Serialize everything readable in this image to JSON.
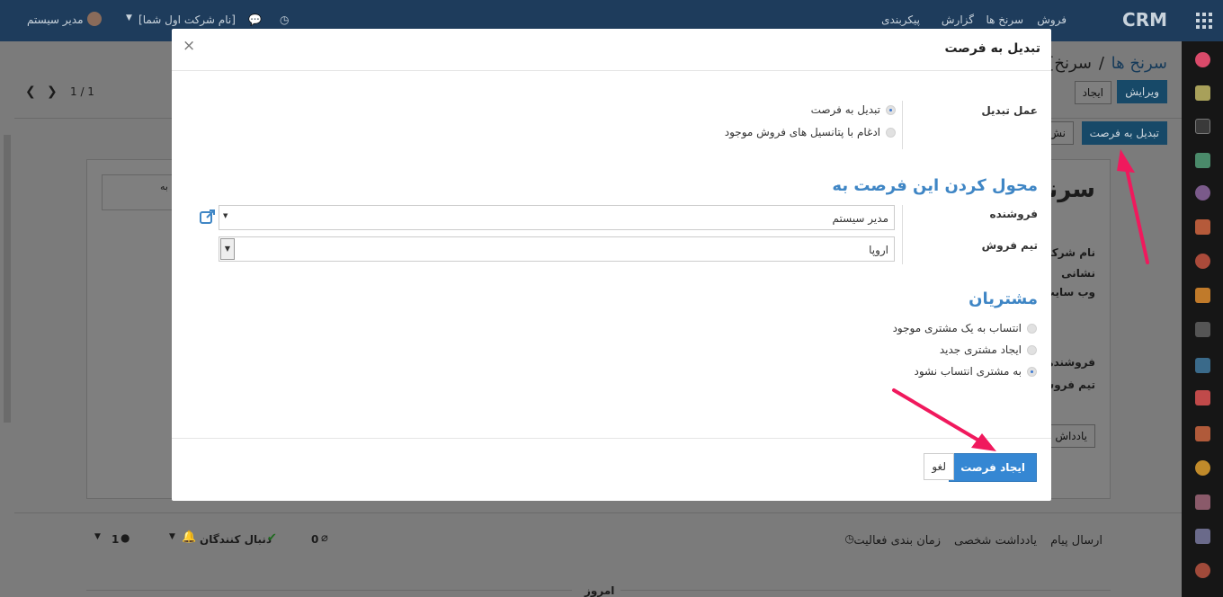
{
  "topbar": {
    "app_title": "CRM",
    "menu": [
      "فروش",
      "سرنخ ها",
      "گزارش",
      "پیکربندی"
    ],
    "user": "مدیر سیستم",
    "company": "[نام شرکت اول شما]"
  },
  "background": {
    "breadcrumb_root": "سرنخ ها",
    "breadcrumb_sep": "/",
    "breadcrumb_current": "[سرنخ",
    "edit_button": "ویرایش",
    "create_button": "ایجاد",
    "pager": "1 / 1",
    "convert_button": "تبدیل به فرصت",
    "mark_button": "نش",
    "record_title": "[سرنخ",
    "left_box_line1": "دیل به",
    "left_box_line2": "یف",
    "fields": [
      "نام شرکت",
      "نشانی",
      "وب سایت",
      "فروشنده",
      "تیم فروش"
    ],
    "notes_tab": "یادداش",
    "chatter": {
      "send_message": "ارسال پیام",
      "log_note": "یادداشت شخصی",
      "schedule": "زمان بندی فعالیت",
      "attachments": "0",
      "followers": "دنبال کنندگان",
      "follower_count": "1",
      "today": "امروز"
    }
  },
  "modal": {
    "title": "تبدیل به فرصت",
    "close": "×",
    "conversion_label": "عمل تبدیل",
    "conversion_options": [
      {
        "label": "تبدیل به فرصت",
        "selected": true
      },
      {
        "label": "ادغام با پتانسیل های فروش موجود",
        "selected": false
      }
    ],
    "assign_section": "محول کردن این فرصت به",
    "salesperson_label": "فروشنده",
    "salesperson_value": "مدیر سیستم",
    "team_label": "تیم فروش",
    "team_value": "اروپا",
    "customers_section": "مشتریان",
    "customer_options": [
      {
        "label": "انتساب به یک مشتری موجود",
        "selected": false
      },
      {
        "label": "ایجاد مشتری جدید",
        "selected": false
      },
      {
        "label": "به مشتری انتساب نشود",
        "selected": true
      }
    ],
    "create_button": "ایجاد فرصت",
    "cancel_button": "لغو"
  },
  "colors": {
    "primary": "#3587d3",
    "section_title": "#3f86c5",
    "annotation_arrow": "#f0195d",
    "topbar": "#1e3c5c"
  }
}
